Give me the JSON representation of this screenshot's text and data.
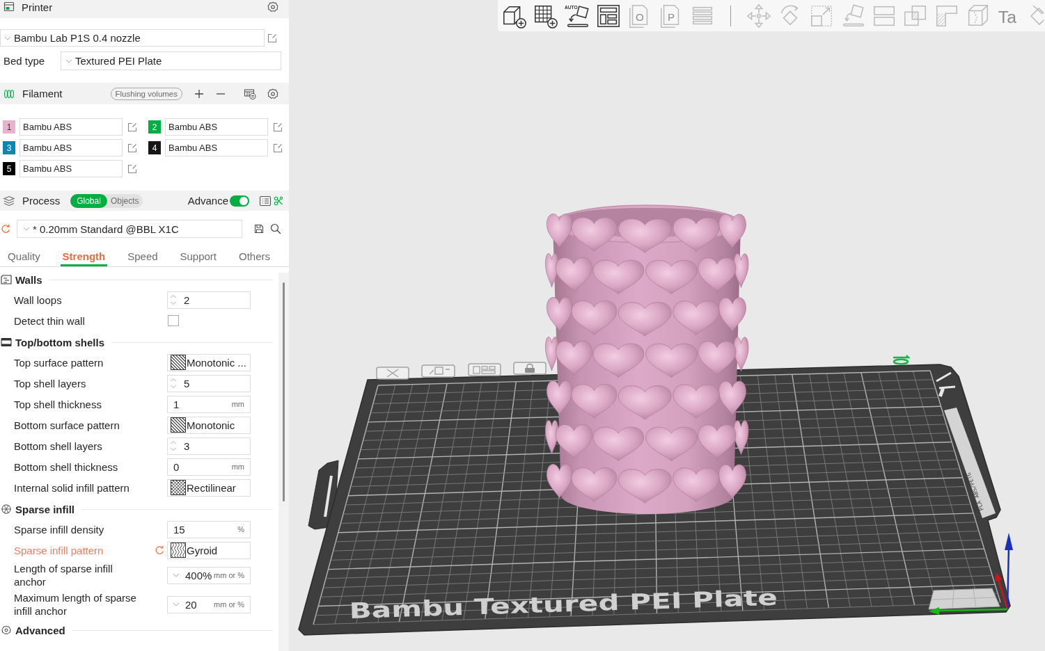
{
  "printer": {
    "title": "Printer",
    "preset": "Bambu Lab P1S 0.4 nozzle",
    "bed_type_label": "Bed type",
    "bed_type": "Textured PEI Plate"
  },
  "filament": {
    "title": "Filament",
    "flushing_button": "Flushing volumes",
    "slots": [
      {
        "number": "1",
        "color": "#e9b3d0",
        "name": "Bambu ABS"
      },
      {
        "number": "2",
        "color": "#00ae42",
        "name": "Bambu ABS"
      },
      {
        "number": "3",
        "color": "#0a86b1",
        "name": "Bambu ABS"
      },
      {
        "number": "4",
        "color": "#161616",
        "name": "Bambu ABS"
      },
      {
        "number": "5",
        "color": "#000000",
        "name": "Bambu ABS"
      }
    ]
  },
  "process": {
    "title": "Process",
    "scope_tabs": [
      {
        "label": "Global",
        "selected": true
      },
      {
        "label": "Objects",
        "selected": false
      }
    ],
    "advance": {
      "label": "Advance",
      "on": true
    },
    "preset": "* 0.20mm Standard @BBL X1C",
    "preset_modified": true
  },
  "tabs": [
    {
      "label": "Quality",
      "selected": false
    },
    {
      "label": "Strength",
      "selected": true
    },
    {
      "label": "Speed",
      "selected": false
    },
    {
      "label": "Support",
      "selected": false
    },
    {
      "label": "Others",
      "selected": false
    }
  ],
  "sections": [
    {
      "title": "Walls",
      "kind": "walls",
      "rows": [
        {
          "label": "Wall loops",
          "kind": "spin",
          "value": "2",
          "modified": false
        },
        {
          "label": "Detect thin wall",
          "kind": "checkbox",
          "checked": false,
          "modified": false
        }
      ]
    },
    {
      "title": "Top/bottom shells",
      "kind": "shells",
      "rows": [
        {
          "label": "Top surface pattern",
          "kind": "pattern",
          "swatch": {
            "kind": "monotonic"
          },
          "value": "Monotonic ...",
          "modified": false
        },
        {
          "label": "Top shell layers",
          "kind": "spin",
          "value": "5",
          "modified": false
        },
        {
          "label": "Top shell thickness",
          "kind": "number",
          "value": "1",
          "unit": "mm",
          "modified": false
        },
        {
          "label": "Bottom surface pattern",
          "kind": "pattern",
          "swatch": {
            "kind": "monotonic"
          },
          "value": "Monotonic",
          "modified": false
        },
        {
          "label": "Bottom shell layers",
          "kind": "spin",
          "value": "3",
          "modified": false
        },
        {
          "label": "Bottom shell thickness",
          "kind": "number",
          "value": "0",
          "unit": "mm",
          "modified": false
        },
        {
          "label": "Internal solid infill pattern",
          "kind": "pattern",
          "swatch": {
            "kind": "rectilinear"
          },
          "value": "Rectilinear",
          "modified": false
        }
      ]
    },
    {
      "title": "Sparse infill",
      "kind": "infill",
      "rows": [
        {
          "label": "Sparse infill density",
          "kind": "number",
          "value": "15",
          "unit": "%",
          "modified": false
        },
        {
          "label": "Sparse infill pattern",
          "kind": "pattern",
          "swatch": {
            "kind": "gyroid"
          },
          "value": "Gyroid",
          "modified": true
        },
        {
          "label": "Length of sparse infill anchor",
          "kind": "combo",
          "value": "400%",
          "unit": "mm or %",
          "modified": false
        },
        {
          "label": "Maximum length of sparse infill anchor",
          "kind": "combo",
          "value": "20",
          "unit": "mm or %",
          "modified": false
        }
      ]
    },
    {
      "title": "Advanced",
      "kind": "advanced"
    }
  ],
  "viewport": {
    "toolbar": [
      {
        "kind": "add-object",
        "disabled": false
      },
      {
        "kind": "add-plate",
        "disabled": false
      },
      {
        "kind": "auto-orient",
        "disabled": false,
        "glyph": "AUTO"
      },
      {
        "kind": "arrange",
        "disabled": false
      },
      {
        "kind": "split-objects",
        "disabled": true,
        "glyph": "O"
      },
      {
        "kind": "split-parts",
        "disabled": true,
        "glyph": "P"
      },
      {
        "kind": "layers",
        "disabled": true
      },
      {
        "kind": "separator"
      },
      {
        "kind": "move",
        "disabled": true
      },
      {
        "kind": "rotate",
        "disabled": true
      },
      {
        "kind": "scale",
        "disabled": true
      },
      {
        "kind": "lay-on-face",
        "disabled": true
      },
      {
        "kind": "cut",
        "disabled": true
      },
      {
        "kind": "boolean",
        "disabled": true
      },
      {
        "kind": "support-paint",
        "disabled": true
      },
      {
        "kind": "seam-paint",
        "disabled": true
      },
      {
        "kind": "text",
        "disabled": true,
        "glyph": "Ta"
      },
      {
        "kind": "color-paint",
        "disabled": true
      }
    ],
    "plate": {
      "label": "Bambu Textured PEI Plate",
      "side_label": "PLA ABS/PETG"
    }
  }
}
